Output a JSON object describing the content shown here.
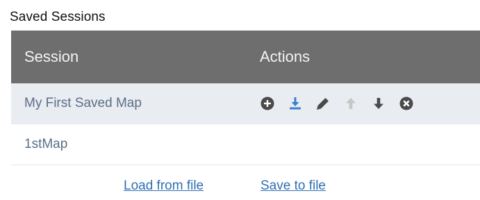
{
  "panel": {
    "title": "Saved Sessions"
  },
  "table": {
    "columns": [
      "Session",
      "Actions"
    ],
    "rows": [
      {
        "name": "My First Saved Map",
        "selected": true
      },
      {
        "name": "1stMap",
        "selected": false
      }
    ],
    "actions": [
      {
        "icon": "plus-circle-icon",
        "color": "#4a4a4a"
      },
      {
        "icon": "download-icon",
        "color": "#3a7fd0"
      },
      {
        "icon": "pencil-icon",
        "color": "#4a4a4a"
      },
      {
        "icon": "arrow-up-icon",
        "color": "#c6c6c6"
      },
      {
        "icon": "arrow-down-icon",
        "color": "#4a4a4a"
      },
      {
        "icon": "close-circle-icon",
        "color": "#4a4a4a"
      }
    ]
  },
  "footer": {
    "load_label": "Load from file",
    "save_label": "Save to file"
  },
  "colors": {
    "header_bg": "#6e6e6e",
    "selected_row_bg": "#e9ecf1",
    "link": "#2f6fb4",
    "row_text": "#5a6f86"
  }
}
